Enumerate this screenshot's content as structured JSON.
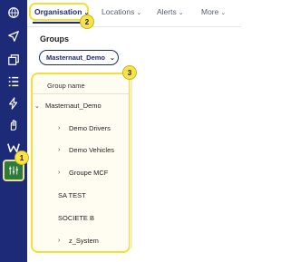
{
  "topbar": {
    "tabs": [
      {
        "label": "Organisation",
        "active": true
      },
      {
        "label": "Locations",
        "active": false
      },
      {
        "label": "Alerts",
        "active": false
      },
      {
        "label": "More",
        "active": false
      }
    ]
  },
  "rail": {
    "icons": [
      "globe-icon",
      "navigation-icon",
      "copy-icon",
      "list-icon",
      "bolt-icon",
      "hand-icon",
      "w-logo-icon",
      "organisation-icon"
    ]
  },
  "panel": {
    "title": "Groups",
    "company_select": "Masternaut_Demo",
    "column_header": "Group name",
    "groups": [
      {
        "label": "Masternaut_Demo",
        "caret": "down"
      },
      {
        "label": "Demo Drivers",
        "caret": "right"
      },
      {
        "label": "Demo Vehicles",
        "caret": "right"
      },
      {
        "label": "Groupe MCF",
        "caret": "right"
      },
      {
        "label": "SA TEST",
        "caret": ""
      },
      {
        "label": "SOCIETE B",
        "caret": ""
      },
      {
        "label": "z_System",
        "caret": "right"
      }
    ]
  },
  "annotations": {
    "badge1": "1",
    "badge2": "2",
    "badge3": "3"
  },
  "colors": {
    "rail": "#1d2a78",
    "highlight": "#f1df3a",
    "active_icon_bg": "#2f7a3b"
  }
}
